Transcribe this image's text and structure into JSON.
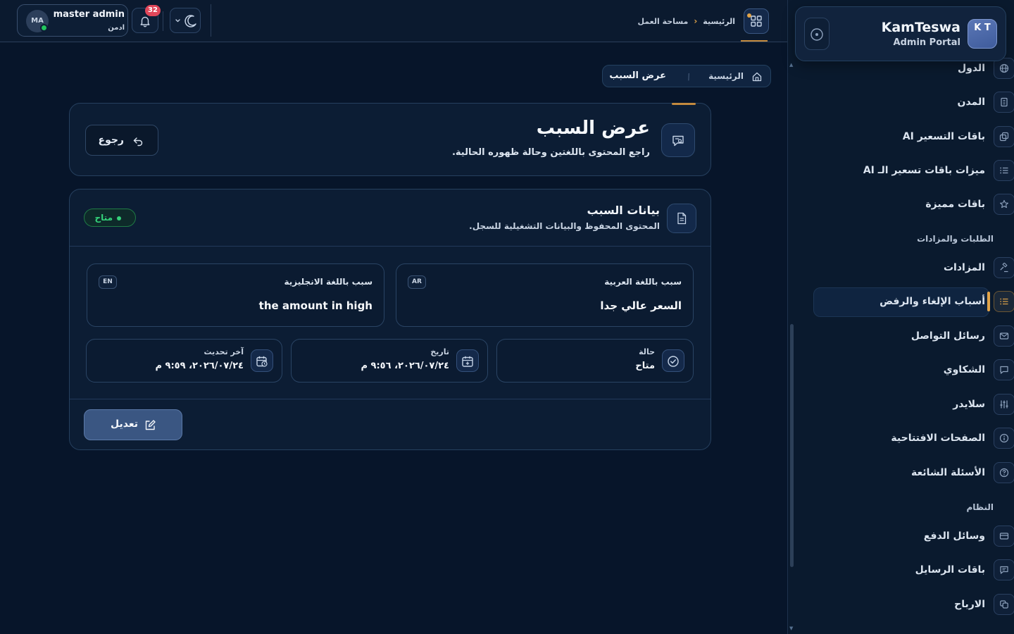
{
  "sidebar": {
    "brand": {
      "logo": "K T",
      "name": "KamTeswa",
      "subtitle": "Admin Portal"
    },
    "items_top": [
      {
        "label": "الدول",
        "icon": "globe-icon"
      },
      {
        "label": "المدن",
        "icon": "building-icon"
      },
      {
        "label": "باقات التسعير AI",
        "icon": "copy-icon"
      },
      {
        "label": "ميزات باقات تسعير الـ AI",
        "icon": "list-icon"
      },
      {
        "label": "باقات مميزة",
        "icon": "star-icon"
      }
    ],
    "section_orders": "الطلبات والمزادات",
    "items_orders": [
      {
        "label": "المزادات",
        "icon": "gavel-icon"
      },
      {
        "label": "أسباب الإلغاء والرفض",
        "icon": "list-icon",
        "active": true
      },
      {
        "label": "رسائل التواصل",
        "icon": "mail-icon"
      },
      {
        "label": "الشكاوي",
        "icon": "message-icon"
      },
      {
        "label": "سلايدر",
        "icon": "sliders-icon"
      },
      {
        "label": "الصفحات الافتتاحية",
        "icon": "info-icon"
      },
      {
        "label": "الأسئلة الشائعة",
        "icon": "help-icon"
      }
    ],
    "section_system": "النظام",
    "items_system": [
      {
        "label": "وسائل الدفع",
        "icon": "card-icon"
      },
      {
        "label": "باقات الرسايل",
        "icon": "chat-icon"
      },
      {
        "label": "الارباح",
        "icon": "coins-icon"
      }
    ]
  },
  "topbar": {
    "breadcrumb_home": "الرئيسية",
    "breadcrumb_current": "مساحة العمل",
    "notifications_count": "32",
    "user": {
      "initials": "MA",
      "name": "master admin",
      "role": "ادمن"
    }
  },
  "page": {
    "breadcrumb_home": "الرئيسية",
    "breadcrumb_current": "عرض السبب",
    "title": "عرض السبب",
    "description": "راجع المحتوى باللغتين وحالة ظهوره الحالية.",
    "back_label": "رجوع"
  },
  "details": {
    "title": "بيانات السبب",
    "subtitle": "المحتوى المحفوظ والبيانات التشغيلية للسجل.",
    "status_badge": "متاح",
    "reason_ar": {
      "label": "سبب باللغة العربية",
      "tag": "AR",
      "value": "السعر عالي جدا"
    },
    "reason_en": {
      "label": "سبب باللغة الانجليزية",
      "tag": "EN",
      "value": "the amount in high"
    },
    "status": {
      "label": "حالة",
      "value": "متاح"
    },
    "created": {
      "label": "تاريخ",
      "value": "٢٠٢٦/٠٧/٢٤، ٩:٥٦ م"
    },
    "updated": {
      "label": "آخر تحديث",
      "value": "٢٠٢٦/٠٧/٢٤، ٩:٥٩ م"
    },
    "edit_label": "تعديل"
  },
  "colors": {
    "accent": "#e0a349",
    "success": "#34d27a",
    "primary_button": "#3a5682",
    "background": "#07152a"
  }
}
